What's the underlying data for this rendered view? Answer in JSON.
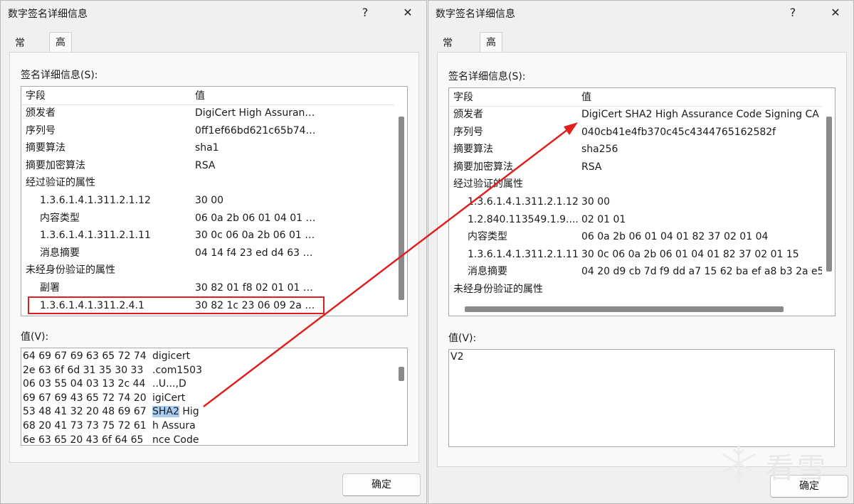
{
  "left": {
    "title": "数字签名详细信息",
    "help": "?",
    "close": "✕",
    "tabs": [
      "常规",
      "高级"
    ],
    "details_label": "签名详细信息(S):",
    "columns": [
      "字段",
      "值"
    ],
    "rows": [
      {
        "field": "颁发者",
        "value": "DigiCert High Assuran…",
        "indent": 0
      },
      {
        "field": "序列号",
        "value": "0ff1ef66bd621c65b74…",
        "indent": 0
      },
      {
        "field": "摘要算法",
        "value": "sha1",
        "indent": 0
      },
      {
        "field": "摘要加密算法",
        "value": "RSA",
        "indent": 0
      },
      {
        "field": "经过验证的属性",
        "value": "",
        "indent": 0
      },
      {
        "field": "1.3.6.1.4.1.311.2.1.12",
        "value": "30 00",
        "indent": 1
      },
      {
        "field": "内容类型",
        "value": "06 0a 2b 06 01 04 01 …",
        "indent": 1
      },
      {
        "field": "1.3.6.1.4.1.311.2.1.11",
        "value": "30 0c 06 0a 2b 06 01 …",
        "indent": 1
      },
      {
        "field": "消息摘要",
        "value": "04 14 f4 23 ed d4 63 …",
        "indent": 1
      },
      {
        "field": "未经身份验证的属性",
        "value": "",
        "indent": 0
      },
      {
        "field": "副署",
        "value": "30 82 01 f8 02 01 01 …",
        "indent": 1
      },
      {
        "field": "1.3.6.1.4.1.311.2.4.1",
        "value": "30 82 1c 23 06 09 2a …",
        "indent": 1
      }
    ],
    "value_label": "值(V):",
    "hex_lines": [
      {
        "hex": "64 69 67 69 63 65 72 74",
        "text": "digicert"
      },
      {
        "hex": "2e 63 6f 6d 31 35 30 33",
        "text": ".com1503"
      },
      {
        "hex": "06 03 55 04 03 13 2c 44",
        "text": "..U...,D"
      },
      {
        "hex": "69 67 69 43 65 72 74 20",
        "text": "igiCert"
      },
      {
        "hex": "53 48 41 32 20 48 69 67",
        "text_hl": "SHA2",
        "text": " Hig"
      },
      {
        "hex": "68 20 41 73 73 75 72 61",
        "text": "h Assura"
      },
      {
        "hex": "6e 63 65 20 43 6f 64 65",
        "text": "nce Code"
      }
    ],
    "ok": "确定"
  },
  "right": {
    "title": "数字签名详细信息",
    "help": "?",
    "close": "✕",
    "tabs": [
      "常规",
      "高级"
    ],
    "details_label": "签名详细信息(S):",
    "columns": [
      "字段",
      "值"
    ],
    "rows": [
      {
        "field": "颁发者",
        "value": "DigiCert SHA2 High Assurance Code Signing CA",
        "indent": 0
      },
      {
        "field": "序列号",
        "value": "040cb41e4fb370c45c4344765162582f",
        "indent": 0
      },
      {
        "field": "摘要算法",
        "value": "sha256",
        "indent": 0
      },
      {
        "field": "摘要加密算法",
        "value": "RSA",
        "indent": 0
      },
      {
        "field": "经过验证的属性",
        "value": "",
        "indent": 0
      },
      {
        "field": "1.3.6.1.4.1.311.2.1.12",
        "value": "30 00",
        "indent": 1
      },
      {
        "field": "1.2.840.113549.1.9....",
        "value": "02 01 01",
        "indent": 1
      },
      {
        "field": "内容类型",
        "value": "06 0a 2b 06 01 04 01 82 37 02 01 04",
        "indent": 1
      },
      {
        "field": "1.3.6.1.4.1.311.2.1.11",
        "value": "30 0c 06 0a 2b 06 01 04 01 82 37 02 01 15",
        "indent": 1
      },
      {
        "field": "消息摘要",
        "value": "04 20 d9 cb 7d f9 dd a7 15 62 ba ef a8 b3 2a e5",
        "indent": 1
      },
      {
        "field": "未经身份验证的属性",
        "value": "",
        "indent": 0
      }
    ],
    "value_label": "值(V):",
    "value_text": "V2",
    "ok": "确定"
  },
  "watermark": {
    "text": "看雪"
  },
  "colors": {
    "highlight_box": "#e02020",
    "selection": "#a8cdf0"
  }
}
